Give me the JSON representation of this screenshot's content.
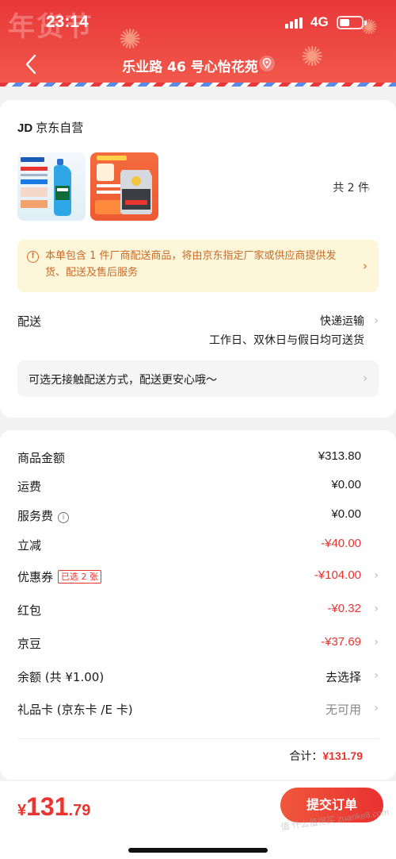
{
  "status_bar": {
    "time": "23:14",
    "network": "4G",
    "battery_level": 0.45
  },
  "header": {
    "deco_text": "年货节",
    "address": "乐业路 46 号心怡花苑"
  },
  "colors": {
    "brand_red": "#e8352f",
    "notice_bg": "#fdf6d9",
    "notice_text": "#c86a2a"
  },
  "shop": {
    "logo": "JD",
    "name": "京东自营"
  },
  "products": {
    "count_label": "共 2 件"
  },
  "notice": {
    "text": "本单包含 1 件厂商配送商品，将由京东指定厂家或供应商提供发货、配送及售后服务"
  },
  "delivery": {
    "label": "配送",
    "method": "快递运输",
    "schedule": "工作日、双休日与假日均可送货",
    "contactless": "可选无接触配送方式，配送更安心哦～"
  },
  "price_rows": [
    {
      "label": "商品金额",
      "value": "¥313.80"
    },
    {
      "label": "运费",
      "value": "¥0.00"
    },
    {
      "label": "服务费",
      "value": "¥0.00"
    },
    {
      "label": "立减",
      "value": "-¥40.00"
    },
    {
      "label": "优惠券",
      "tag": "已选 2 张",
      "value": "-¥104.00"
    },
    {
      "label": "红包",
      "value": "-¥0.32"
    },
    {
      "label": "京豆",
      "value": "-¥37.69"
    },
    {
      "label": "余额 (共 ¥1.00)",
      "value": "去选择"
    },
    {
      "label": "礼品卡 (京东卡 /E 卡)",
      "value": "无可用"
    }
  ],
  "total": {
    "label": "合计：",
    "amount": "¥131.79"
  },
  "bottom": {
    "currency": "¥",
    "integer": "131",
    "decimal": ".79",
    "submit_label": "提交订单",
    "watermark": "值 什么值得买 zuanke8.com"
  }
}
